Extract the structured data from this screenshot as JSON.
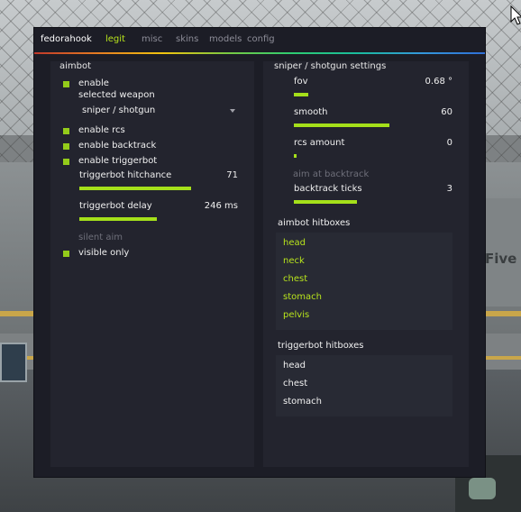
{
  "background": {
    "sign_text": "Five"
  },
  "menu": {
    "brand": "fedorahook",
    "tabs": [
      {
        "label": "legit",
        "active": true
      },
      {
        "label": "misc",
        "active": false
      },
      {
        "label": "skins",
        "active": false
      },
      {
        "label": "models",
        "active": false
      },
      {
        "label": "config",
        "active": false
      }
    ],
    "accent_color": "#b9e51c"
  },
  "aimbot": {
    "title": "aimbot",
    "enable_label": "enable",
    "enable_checked": true,
    "selected_weapon_label": "selected weapon",
    "selected_weapon_value": "sniper / shotgun",
    "rcs_label": "enable rcs",
    "rcs_checked": true,
    "backtrack_label": "enable backtrack",
    "backtrack_checked": true,
    "triggerbot_label": "enable triggerbot",
    "triggerbot_checked": true,
    "hitchance_label": "triggerbot hitchance",
    "hitchance_value": "71",
    "hitchance_fraction": 0.71,
    "delay_label": "triggerbot delay",
    "delay_value": "246 ms",
    "delay_fraction": 0.49,
    "silent_aim_label": "silent aim",
    "silent_aim_enabled": false,
    "visible_only_label": "visible only",
    "visible_only_checked": true
  },
  "weapon_settings": {
    "title": "sniper / shotgun settings",
    "fov_label": "fov",
    "fov_value": "0.68 °",
    "fov_fraction": 0.09,
    "smooth_label": "smooth",
    "smooth_value": "60",
    "smooth_fraction": 0.6,
    "rcs_amount_label": "rcs amount",
    "rcs_amount_value": "0",
    "rcs_amount_fraction": 0.0,
    "aim_at_backtrack_label": "aim at backtrack",
    "aim_at_backtrack_enabled": false,
    "backtrack_ticks_label": "backtrack ticks",
    "backtrack_ticks_value": "3",
    "backtrack_ticks_fraction": 0.4,
    "aimbot_hitboxes_title": "aimbot hitboxes",
    "aimbot_hitboxes": [
      {
        "label": "head",
        "selected": true
      },
      {
        "label": "neck",
        "selected": true
      },
      {
        "label": "chest",
        "selected": true
      },
      {
        "label": "stomach",
        "selected": true
      },
      {
        "label": "pelvis",
        "selected": true
      }
    ],
    "triggerbot_hitboxes_title": "triggerbot hitboxes",
    "triggerbot_hitboxes": [
      {
        "label": "head",
        "selected": false
      },
      {
        "label": "chest",
        "selected": false
      },
      {
        "label": "stomach",
        "selected": false
      }
    ]
  }
}
